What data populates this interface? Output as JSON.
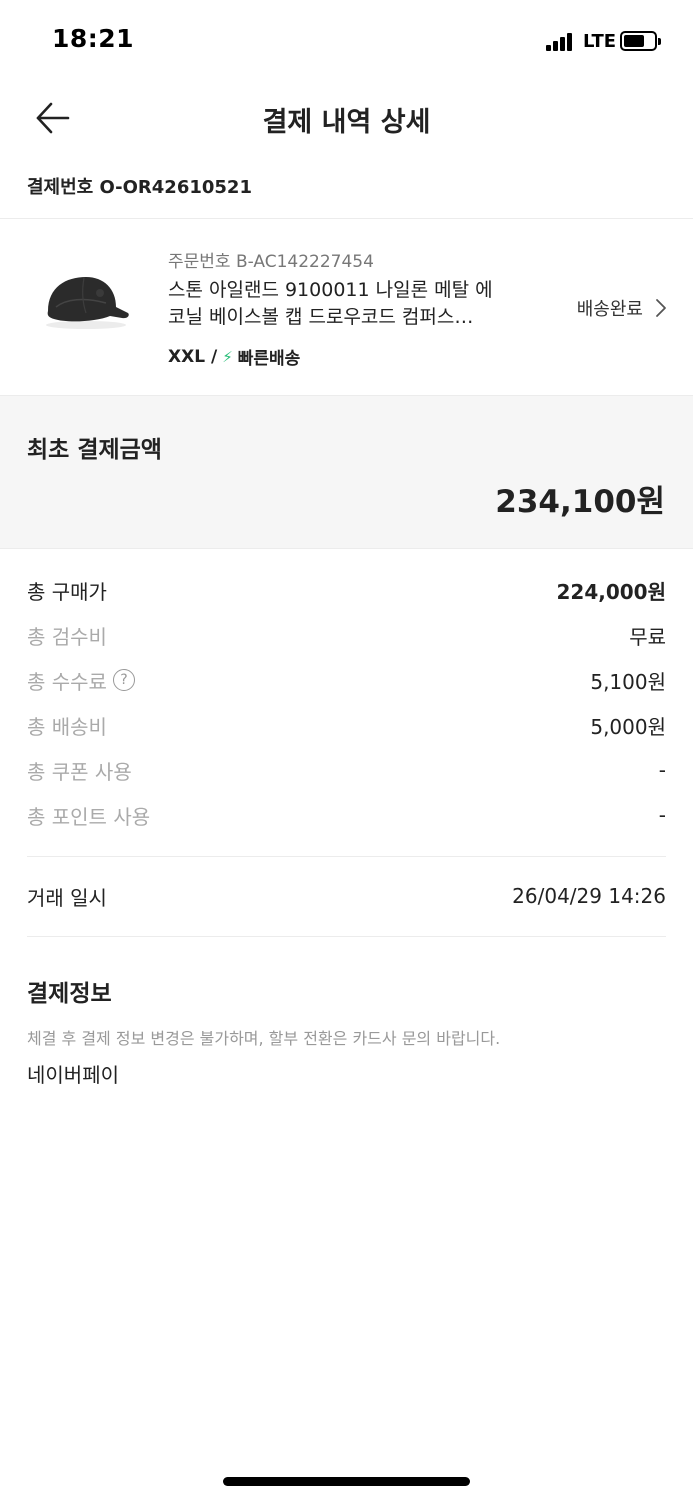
{
  "status_bar": {
    "time": "18:21",
    "network": "LTE"
  },
  "header": {
    "title": "결제 내역 상세"
  },
  "payment_number": "결제번호 O-OR42610521",
  "order": {
    "order_number": "주문번호 B-AC142227454",
    "product_name_line1": "스톤 아일랜드 9100011 나일론 메탈 에",
    "product_name_line2": "코닐 베이스볼 캡 드로우코드 컴퍼스…",
    "size": "XXL /",
    "shipping_type": "빠른배송",
    "status": "배송완료"
  },
  "total": {
    "label": "최초 결제금액",
    "amount": "234,100원"
  },
  "breakdown": [
    {
      "label": "총 구매가",
      "value": "224,000원"
    },
    {
      "label": "총 검수비",
      "value": "무료"
    },
    {
      "label": "총 수수료",
      "value": "5,100원"
    },
    {
      "label": "총 배송비",
      "value": "5,000원"
    },
    {
      "label": "총 쿠폰 사용",
      "value": "-"
    },
    {
      "label": "총 포인트 사용",
      "value": "-"
    }
  ],
  "transaction": {
    "label": "거래 일시",
    "value": "26/04/29 14:26"
  },
  "payment_info": {
    "title": "결제정보",
    "notice": "체결 후 결제 정보 변경은 불가하며, 할부 전환은 카드사 문의 바랍니다.",
    "method": "네이버페이"
  },
  "icons": {
    "back": "arrow-left-icon",
    "chevron": "chevron-right-icon",
    "help": "question-circle-icon",
    "bolt": "lightning-icon",
    "product": "black-baseball-cap-image"
  },
  "colors": {
    "accent_green": "#2bbf7a",
    "muted_text": "#aaaaaa",
    "panel_bg": "#f6f6f6"
  }
}
